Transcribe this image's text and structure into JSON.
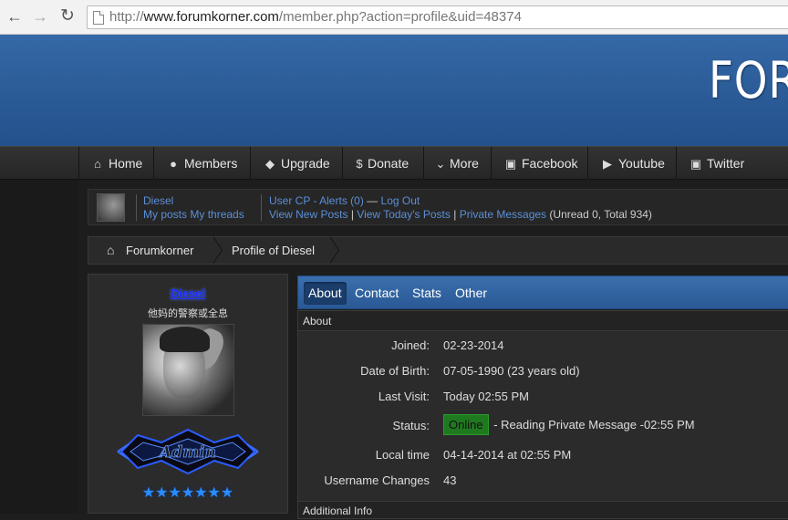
{
  "browser": {
    "url_host": "www.forumkorner.com",
    "url_prefix": "http://",
    "url_path": "/member.php?action=profile&uid=48374",
    "back_icon": "arrow-left",
    "forward_icon": "arrow-right",
    "reload_icon": "reload"
  },
  "header": {
    "logo_text": "FOR"
  },
  "nav": {
    "items": [
      {
        "label": "Home",
        "icon": "home-icon"
      },
      {
        "label": "Members",
        "icon": "users-icon"
      },
      {
        "label": "Upgrade",
        "icon": "tag-icon"
      },
      {
        "label": "Donate",
        "icon": "dollar-icon"
      },
      {
        "label": "More",
        "icon": "chevron-down-icon"
      },
      {
        "label": "Facebook",
        "icon": "facebook-icon"
      },
      {
        "label": "Youtube",
        "icon": "play-icon"
      },
      {
        "label": "Twitter",
        "icon": "twitter-icon"
      }
    ]
  },
  "userpanel": {
    "username": "Diesel",
    "my_posts": "My posts",
    "my_threads": "My threads",
    "user_cp": "User CP",
    "dash": "-",
    "alerts": "Alerts (0)",
    "emdash": "—",
    "logout": "Log Out",
    "view_new_posts": "View New Posts",
    "pipe": "|",
    "view_today_posts": "View Today's Posts",
    "private_messages": "Private Messages",
    "pm_counts": "(Unread 0, Total 934)"
  },
  "breadcrumb": {
    "home": "Forumkorner",
    "current": "Profile of Diesel"
  },
  "profile": {
    "name": "Diesel",
    "title": "他妈的警察或全息",
    "badge_text": "Admin",
    "stars": "★★★★★★★",
    "star_count": 7
  },
  "tabs": [
    "About",
    "Contact",
    "Stats",
    "Other"
  ],
  "about": {
    "section_title": "About",
    "rows": [
      {
        "label": "Joined:",
        "value": "02-23-2014"
      },
      {
        "label": "Date of Birth:",
        "value": "07-05-1990 (23 years old)"
      },
      {
        "label": "Last Visit:",
        "value": "Today 02:55 PM"
      },
      {
        "label": "Status:",
        "badge": "Online",
        "value": "- Reading Private Message -02:55 PM"
      },
      {
        "label": "Local time",
        "value": "04-14-2014 at 02:55 PM"
      },
      {
        "label": "Username Changes",
        "value": "43"
      }
    ],
    "next_section": "Additional Info"
  },
  "colors": {
    "banner": "#2c5d9a",
    "link": "#5b8fd8",
    "online": "#1f7a1f",
    "star": "#2a8cff",
    "name": "#1a2eff"
  }
}
